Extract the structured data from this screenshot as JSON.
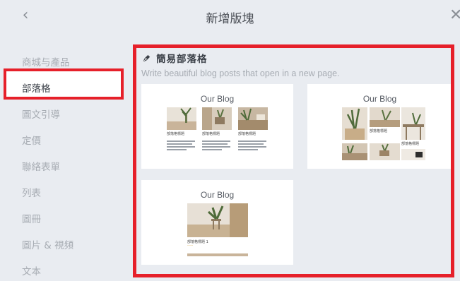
{
  "header": {
    "title": "新增版塊",
    "back_icon": "chevron-left-icon",
    "close_icon": "close-icon"
  },
  "sidebar": {
    "items": [
      {
        "label": "商城与產品",
        "active": false
      },
      {
        "label": "部落格",
        "active": true
      },
      {
        "label": "圖文引導",
        "active": false
      },
      {
        "label": "定價",
        "active": false
      },
      {
        "label": "聯絡表單",
        "active": false
      },
      {
        "label": "列表",
        "active": false
      },
      {
        "label": "圖冊",
        "active": false
      },
      {
        "label": "圖片 & 視頻",
        "active": false
      },
      {
        "label": "文本",
        "active": false
      }
    ]
  },
  "section": {
    "icon": "pen-nib-icon",
    "title": "簡易部落格",
    "description": "Write beautiful blog posts that open in a new page."
  },
  "cards": [
    {
      "title": "Our Blog",
      "layout": "three-column"
    },
    {
      "title": "Our Blog",
      "layout": "masonry-grid"
    },
    {
      "title": "Our Blog",
      "layout": "single-large"
    }
  ],
  "colors": {
    "highlight": "#e6202a",
    "background": "#e9ecf1",
    "active_text": "#3b4048",
    "muted_text": "#a7acb3",
    "price_accent": "#d4a238"
  }
}
